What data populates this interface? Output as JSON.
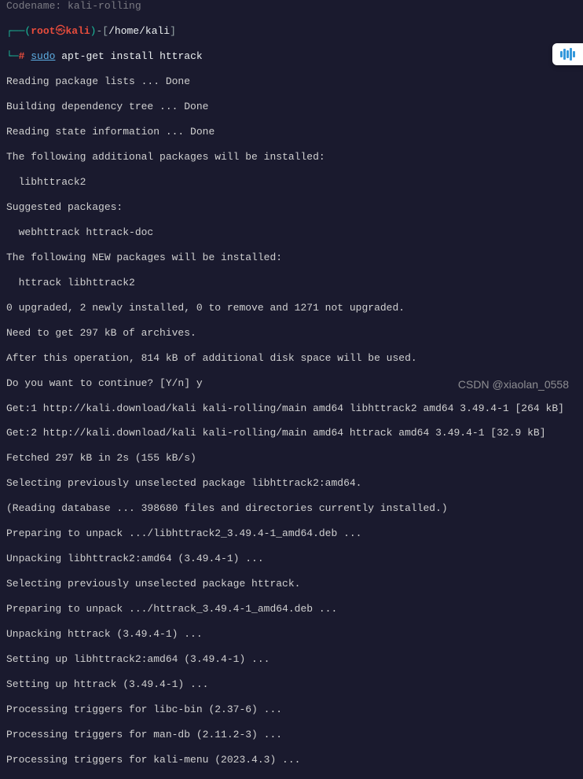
{
  "top_partial": "Codename:       kali-rolling",
  "prompt": {
    "open_paren": "┌──(",
    "user": "root",
    "at": "㉿",
    "host": "kali",
    "close_paren": ")",
    "dash_open": "-[",
    "path": "/home/kali",
    "close_bracket": "]",
    "line2_prefix": "└─",
    "hash": "#",
    "sudo": "sudo",
    "cmd_rest": " apt-get install httrack"
  },
  "output": [
    "Reading package lists ... Done",
    "Building dependency tree ... Done",
    "Reading state information ... Done",
    "The following additional packages will be installed:",
    "  libhttrack2",
    "Suggested packages:",
    "  webhttrack httrack-doc",
    "The following NEW packages will be installed:",
    "  httrack libhttrack2",
    "0 upgraded, 2 newly installed, 0 to remove and 1271 not upgraded.",
    "Need to get 297 kB of archives.",
    "After this operation, 814 kB of additional disk space will be used.",
    "Do you want to continue? [Y/n] y",
    "Get:1 http://kali.download/kali kali-rolling/main amd64 libhttrack2 amd64 3.49.4-1 [264 kB]",
    "Get:2 http://kali.download/kali kali-rolling/main amd64 httrack amd64 3.49.4-1 [32.9 kB]",
    "Fetched 297 kB in 2s (155 kB/s)",
    "Selecting previously unselected package libhttrack2:amd64.",
    "(Reading database ... 398680 files and directories currently installed.)",
    "Preparing to unpack .../libhttrack2_3.49.4-1_amd64.deb ...",
    "Unpacking libhttrack2:amd64 (3.49.4-1) ...",
    "Selecting previously unselected package httrack.",
    "Preparing to unpack .../httrack_3.49.4-1_amd64.deb ...",
    "Unpacking httrack (3.49.4-1) ...",
    "Setting up libhttrack2:amd64 (3.49.4-1) ...",
    "Setting up httrack (3.49.4-1) ...",
    "Processing triggers for libc-bin (2.37-6) ...",
    "Processing triggers for man-db (2.11.2-3) ...",
    "Processing triggers for kali-menu (2023.4.3) ..."
  ],
  "watermark": "CSDN @xiaolan_0558"
}
